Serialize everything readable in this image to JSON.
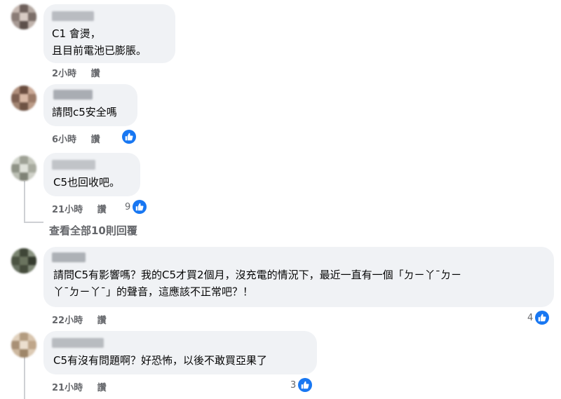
{
  "comments": [
    {
      "text": "C1 會燙，\n且目前電池已膨脹。",
      "time": "2小時",
      "reply": "讚"
    },
    {
      "text": "請問c5安全嗎",
      "time": "6小時",
      "reply": "讚",
      "reaction_count": ""
    },
    {
      "text": "C5也回收吧。",
      "time": "21小時",
      "reply": "讚",
      "reaction_count": "9",
      "view_replies": "查看全部10則回覆"
    },
    {
      "text": "請問C5有影響嗎？我的C5才買2個月，沒充電的情況下，最近一直有一個「ㄉㄧ丫ˉㄉㄧ\n丫ˉㄉㄧ丫ˉ」的聲音，這應該不正常吧？！",
      "time": "22小時",
      "reply": "讚",
      "reaction_count": "4"
    },
    {
      "text": "C5有沒有問題啊？好恐怖，以後不敢買亞果了",
      "time": "21小時",
      "reply": "讚",
      "reaction_count": "3"
    }
  ],
  "colors": {
    "bubble": "#f0f2f5",
    "meta": "#65676b",
    "like": "#1877f2"
  },
  "icons": [
    "like-icon"
  ]
}
